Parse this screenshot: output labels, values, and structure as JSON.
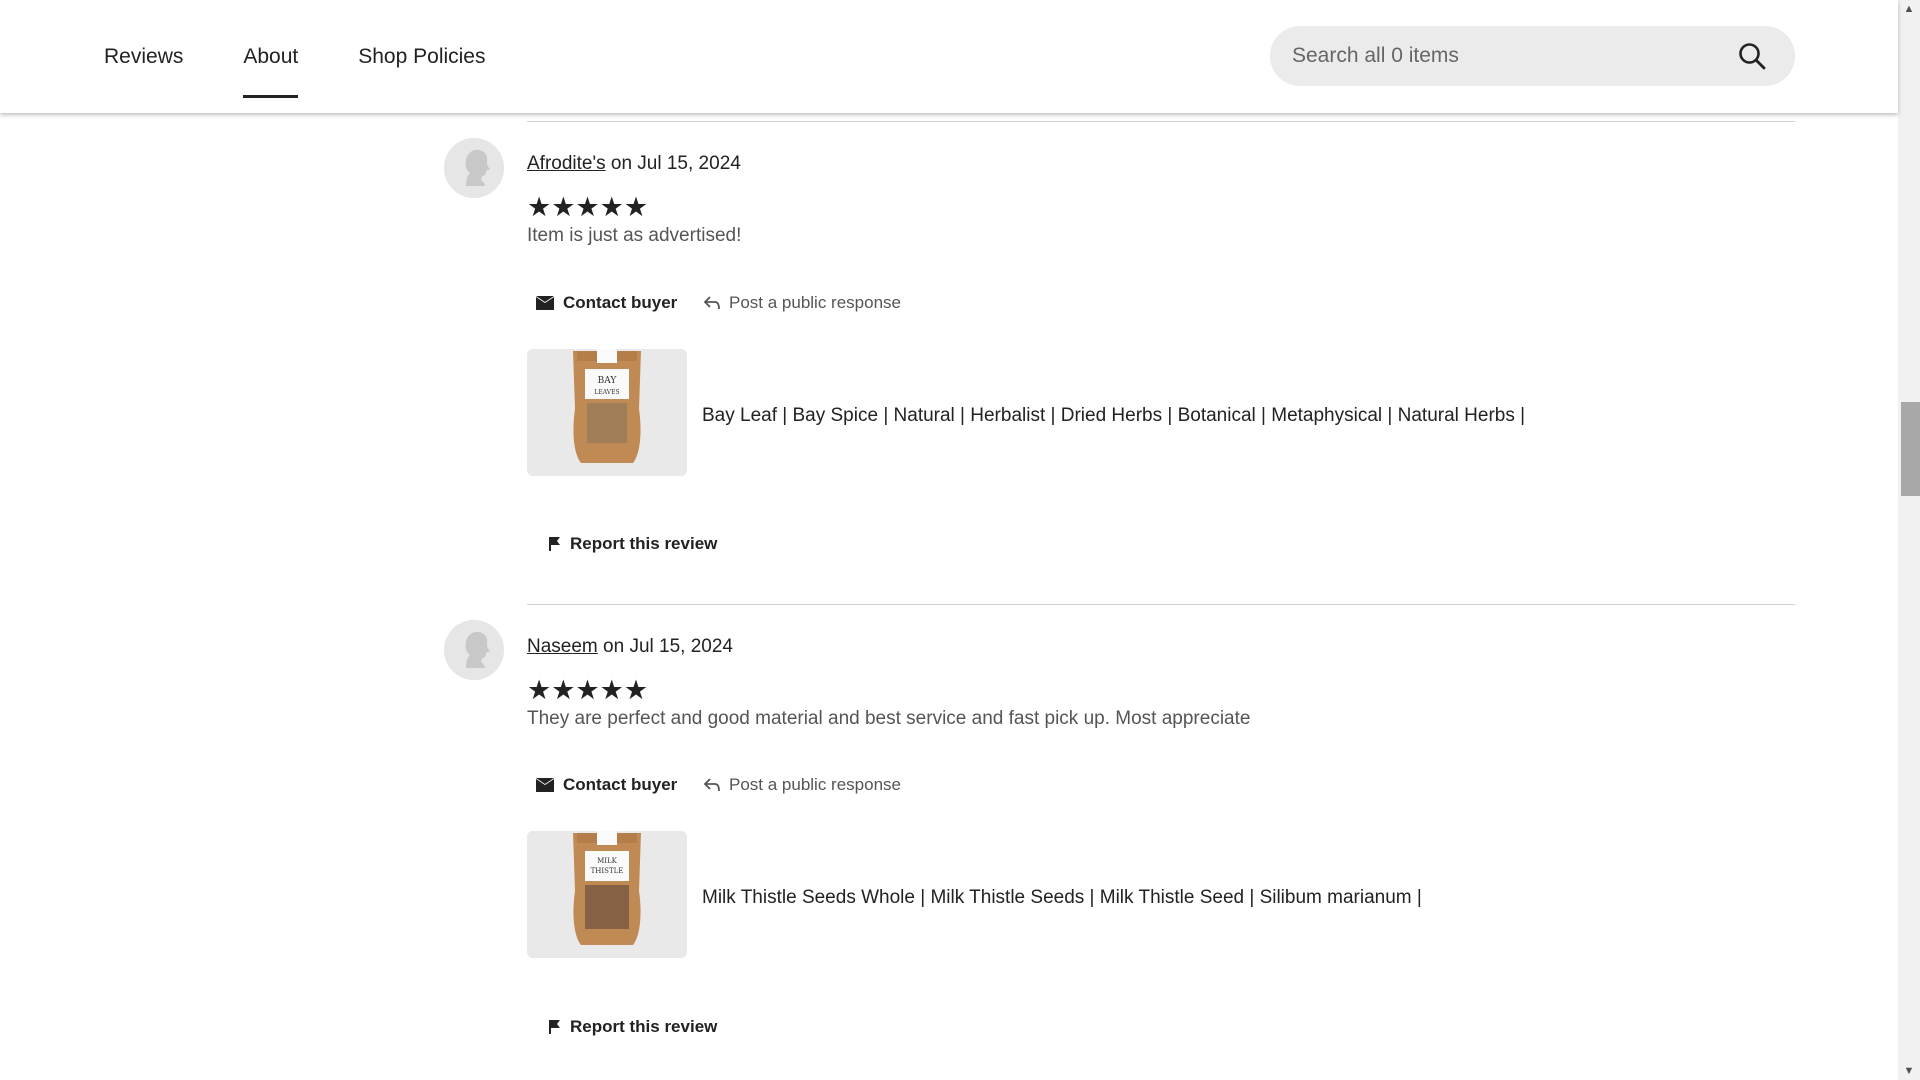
{
  "nav": {
    "tabs": [
      {
        "label": "Reviews"
      },
      {
        "label": "About"
      },
      {
        "label": "Shop Policies"
      }
    ],
    "active_tab": "About"
  },
  "search": {
    "placeholder": "Search all 0 items",
    "icon": "search-icon"
  },
  "reviews": [
    {
      "user": "Afrodite's",
      "date": "on Jul 15, 2024",
      "rating": 5,
      "stars": "★★★★★",
      "text": "Item is just as advertised!",
      "contact_label": "Contact buyer",
      "response_label": "Post a public response",
      "listing_title": "Bay Leaf | Bay Spice | Natural | Herbalist | Dried Herbs | Botanical | Metaphysical | Natural Herbs |",
      "listing_image_label": "BAY LEAVES",
      "report_label": "Report this review"
    },
    {
      "user": "Naseem",
      "date": "on Jul 15, 2024",
      "rating": 5,
      "stars": "★★★★★",
      "text": "They are perfect and good material and best service and fast pick up. Most appreciate",
      "contact_label": "Contact buyer",
      "response_label": "Post a public response",
      "listing_title": "Milk Thistle Seeds Whole | Milk Thistle Seeds | Milk Thistle Seed | Silibum marianum |",
      "listing_image_label": "MILK THISTLE",
      "report_label": "Report this review"
    }
  ],
  "colors": {
    "text": "#222222",
    "muted": "#555555",
    "search_bg": "#ebebeb",
    "divider": "#d0d0d0"
  }
}
